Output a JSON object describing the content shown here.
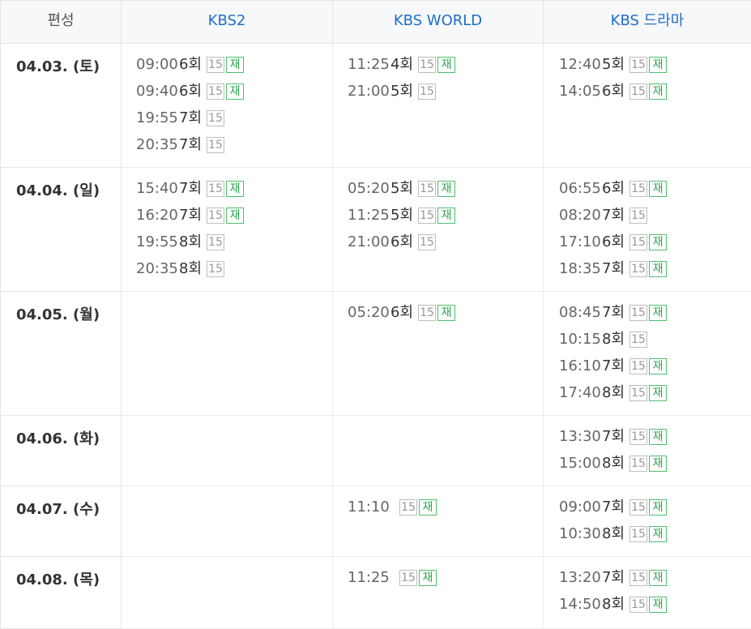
{
  "header": {
    "corner_label": "편성",
    "channels": [
      "KBS2",
      "KBS WORLD",
      "KBS 드라마"
    ]
  },
  "badge_labels": {
    "age": "15",
    "rerun": "재"
  },
  "rows": [
    {
      "date": "04.03. (토)",
      "cells": [
        [
          {
            "time": "09:00",
            "ep": "6회",
            "rerun": true
          },
          {
            "time": "09:40",
            "ep": "6회",
            "rerun": true
          },
          {
            "time": "19:55",
            "ep": "7회",
            "rerun": false
          },
          {
            "time": "20:35",
            "ep": "7회",
            "rerun": false
          }
        ],
        [
          {
            "time": "11:25",
            "ep": "4회",
            "rerun": true
          },
          {
            "time": "21:00",
            "ep": "5회",
            "rerun": false
          }
        ],
        [
          {
            "time": "12:40",
            "ep": "5회",
            "rerun": true
          },
          {
            "time": "14:05",
            "ep": "6회",
            "rerun": true
          }
        ]
      ]
    },
    {
      "date": "04.04. (일)",
      "cells": [
        [
          {
            "time": "15:40",
            "ep": "7회",
            "rerun": true
          },
          {
            "time": "16:20",
            "ep": "7회",
            "rerun": true
          },
          {
            "time": "19:55",
            "ep": "8회",
            "rerun": false
          },
          {
            "time": "20:35",
            "ep": "8회",
            "rerun": false
          }
        ],
        [
          {
            "time": "05:20",
            "ep": "5회",
            "rerun": true
          },
          {
            "time": "11:25",
            "ep": "5회",
            "rerun": true
          },
          {
            "time": "21:00",
            "ep": "6회",
            "rerun": false
          }
        ],
        [
          {
            "time": "06:55",
            "ep": "6회",
            "rerun": true
          },
          {
            "time": "08:20",
            "ep": "7회",
            "rerun": false
          },
          {
            "time": "17:10",
            "ep": "6회",
            "rerun": true
          },
          {
            "time": "18:35",
            "ep": "7회",
            "rerun": true
          }
        ]
      ]
    },
    {
      "date": "04.05. (월)",
      "cells": [
        [],
        [
          {
            "time": "05:20",
            "ep": "6회",
            "rerun": true
          }
        ],
        [
          {
            "time": "08:45",
            "ep": "7회",
            "rerun": true
          },
          {
            "time": "10:15",
            "ep": "8회",
            "rerun": false
          },
          {
            "time": "16:10",
            "ep": "7회",
            "rerun": true
          },
          {
            "time": "17:40",
            "ep": "8회",
            "rerun": true
          }
        ]
      ]
    },
    {
      "date": "04.06. (화)",
      "cells": [
        [],
        [],
        [
          {
            "time": "13:30",
            "ep": "7회",
            "rerun": true
          },
          {
            "time": "15:00",
            "ep": "8회",
            "rerun": true
          }
        ]
      ]
    },
    {
      "date": "04.07. (수)",
      "cells": [
        [],
        [
          {
            "time": "11:10",
            "ep": "",
            "rerun": true
          }
        ],
        [
          {
            "time": "09:00",
            "ep": "7회",
            "rerun": true
          },
          {
            "time": "10:30",
            "ep": "8회",
            "rerun": true
          }
        ]
      ]
    },
    {
      "date": "04.08. (목)",
      "cells": [
        [],
        [
          {
            "time": "11:25",
            "ep": "",
            "rerun": true
          }
        ],
        [
          {
            "time": "13:20",
            "ep": "7회",
            "rerun": true
          },
          {
            "time": "14:50",
            "ep": "8회",
            "rerun": true
          }
        ]
      ]
    }
  ]
}
